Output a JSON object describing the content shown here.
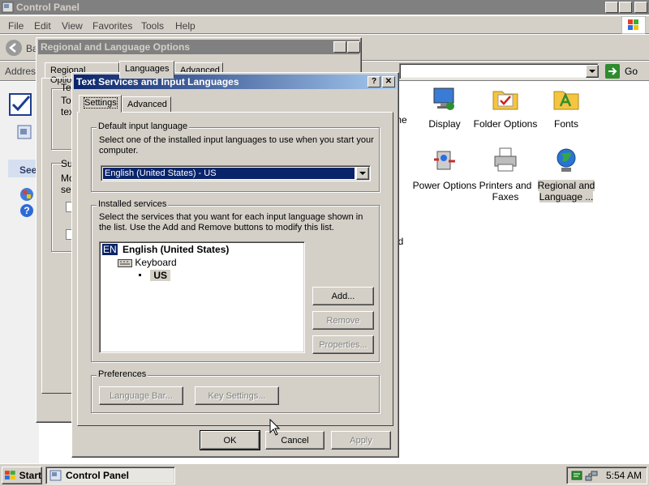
{
  "control_panel": {
    "title": "Control Panel",
    "menu": [
      "File",
      "Edit",
      "View",
      "Favorites",
      "Tools",
      "Help"
    ],
    "back_label": "Ba",
    "address_label": "Address",
    "go_label": "Go",
    "left_panel": {
      "see_label": "See"
    },
    "items": [
      {
        "label": "ime",
        "row": 1
      },
      {
        "label": "Display"
      },
      {
        "label": "Folder Options"
      },
      {
        "label": "Fonts"
      },
      {
        "label_line1": "d",
        "label_line2": "."
      },
      {
        "label": "Power Options"
      },
      {
        "label_line1": "Printers and",
        "label_line2": "Faxes"
      },
      {
        "label_line1": "Regional and",
        "label_line2": "Language ..."
      },
      {
        "label_line1": "nd",
        "label_line2": "u"
      }
    ]
  },
  "regional_dialog": {
    "title": "Regional and Language Options",
    "tabs": [
      "Regional Options",
      "Languages",
      "Advanced"
    ],
    "fragments": [
      "Te",
      "To",
      "tex",
      "Su",
      "Mo",
      "sel"
    ]
  },
  "text_services_dialog": {
    "title": "Text Services and Input Languages",
    "tabs": [
      "Settings",
      "Advanced"
    ],
    "default_input": {
      "group_label": "Default input language",
      "description": "Select one of the installed input languages to use when you start your computer.",
      "selected": "English (United States) - US"
    },
    "installed_services": {
      "group_label": "Installed services",
      "description": "Select the services that you want for each input language shown in the list. Use the Add and Remove buttons to modify this list.",
      "tree": {
        "language_badge": "EN",
        "language": "English (United States)",
        "category": "Keyboard",
        "layout": "US"
      },
      "buttons": {
        "add": "Add...",
        "remove": "Remove",
        "properties": "Properties..."
      }
    },
    "preferences": {
      "group_label": "Preferences",
      "language_bar": "Language Bar...",
      "key_settings": "Key Settings..."
    },
    "footer": {
      "ok": "OK",
      "cancel": "Cancel",
      "apply": "Apply"
    }
  },
  "taskbar": {
    "start_label": "Start",
    "task_label": "Control Panel",
    "clock": "5:54 AM"
  }
}
